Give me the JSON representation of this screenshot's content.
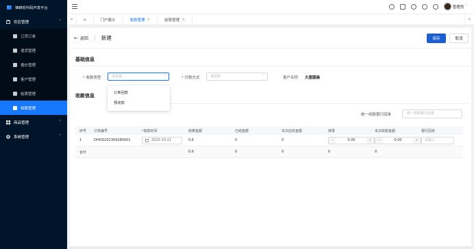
{
  "app": {
    "title": "锦耕低代码开发平台"
  },
  "sidebar": {
    "groups": [
      {
        "label": "供应管理",
        "expanded": true,
        "icon": "box-icon",
        "items": [
          {
            "label": "订货订单",
            "icon": "order-icon"
          },
          {
            "label": "退货管理",
            "icon": "return-icon"
          },
          {
            "label": "报价管理",
            "icon": "quote-icon"
          },
          {
            "label": "客户管理",
            "icon": "user-icon"
          },
          {
            "label": "结算管理",
            "icon": "settle-icon"
          },
          {
            "label": "收款管理",
            "icon": "payment-icon",
            "active": true
          }
        ]
      },
      {
        "label": "商品管理",
        "expanded": false,
        "icon": "grid-icon"
      },
      {
        "label": "系统管理",
        "expanded": false,
        "icon": "gear-icon"
      }
    ]
  },
  "topbar": {
    "username": "管理员"
  },
  "tabs": [
    {
      "label": "门户展示",
      "closable": false
    },
    {
      "label": "收款管理",
      "closable": true,
      "active": true
    },
    {
      "label": "结算管理",
      "closable": true
    }
  ],
  "page": {
    "back_label": "返回",
    "title": "新建",
    "save_label": "保存",
    "cancel_label": "取消"
  },
  "basic": {
    "title": "基础信息",
    "payment_type_label": "收款类型",
    "payment_type_placeholder": "请选择",
    "pay_method_label": "付款方式",
    "pay_method_placeholder": "请选择",
    "customer_label": "客户名称",
    "customer_value": "大唐服装",
    "dropdown_options": [
      "订单回款",
      "预收款"
    ]
  },
  "receipt": {
    "title": "收款信息",
    "unified_label": "统一收款银行回单",
    "unified_placeholder": "统一收款银行回单"
  },
  "table": {
    "headers": [
      "序号",
      "订单编号",
      "*收款时间",
      "结算金额",
      "已结金额",
      "本次应收金额",
      "抹零",
      "本次收款金额",
      "银行回单"
    ],
    "rows": [
      {
        "index": "1",
        "order_no": "DHDD202309280001",
        "date": "2023-10-11",
        "settle": "0.6",
        "settled": "0",
        "due": "0",
        "round_off": "0.00",
        "receive": "0.00",
        "receipt_placeholder": "请输入"
      }
    ],
    "summary": {
      "label": "合计",
      "settle": "0.6",
      "settled": "0",
      "due": "0",
      "round_off": "0",
      "receive": "0"
    }
  }
}
